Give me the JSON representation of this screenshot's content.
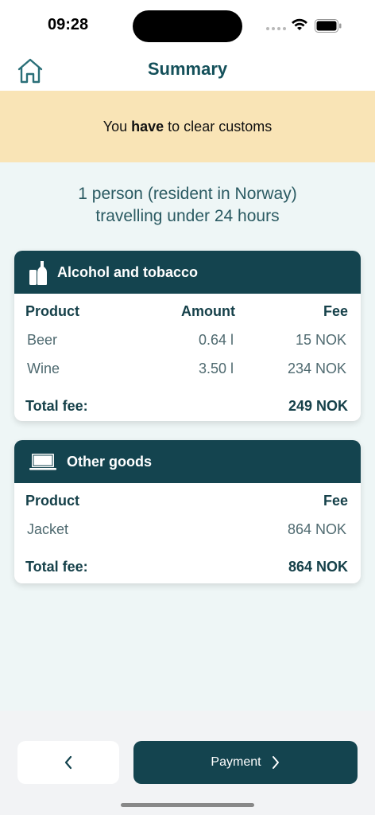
{
  "status": {
    "time": "09:28"
  },
  "header": {
    "title": "Summary",
    "home_icon": "house-icon"
  },
  "banner": {
    "prefix": "You",
    "emphasis": "have",
    "suffix": "to clear customs",
    "color": "#f9e4b6"
  },
  "traveller": {
    "line1": "1 person (resident in Norway)",
    "line2": "travelling under 24 hours"
  },
  "alcohol_card": {
    "title": "Alcohol and tobacco",
    "icon": "bottles-icon",
    "columns": {
      "product": "Product",
      "amount": "Amount",
      "fee": "Fee"
    },
    "items": [
      {
        "product": "Beer",
        "amount": "0.64 l",
        "fee": "15 NOK"
      },
      {
        "product": "Wine",
        "amount": "3.50 l",
        "fee": "234 NOK"
      }
    ],
    "total_label": "Total fee:",
    "total_value": "249 NOK"
  },
  "goods_card": {
    "title": "Other goods",
    "icon": "laptop-icon",
    "columns": {
      "product": "Product",
      "fee": "Fee"
    },
    "items": [
      {
        "product": "Jacket",
        "fee": "864 NOK"
      }
    ],
    "total_label": "Total fee:",
    "total_value": "864 NOK"
  },
  "footer": {
    "back_icon": "chevron-left-icon",
    "payment_label": "Payment",
    "payment_icon": "chevron-right-icon"
  },
  "colors": {
    "primary": "#14444f",
    "background": "#eef6f6"
  }
}
